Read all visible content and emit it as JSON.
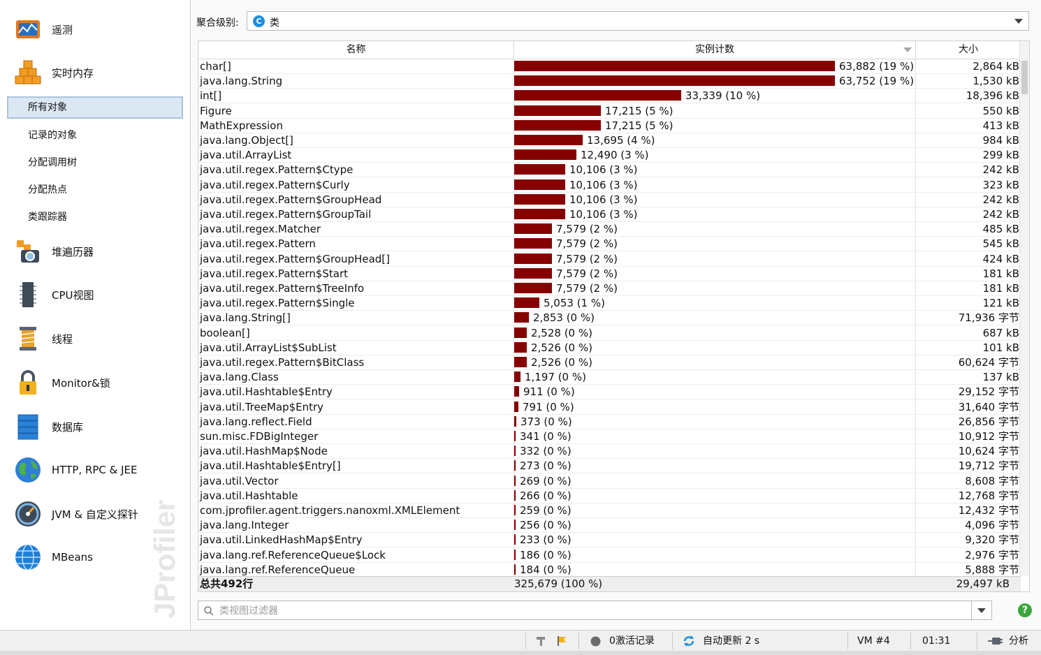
{
  "sidebar": {
    "telemetry": "遥测",
    "live_memory": "实时内存",
    "sub_items": [
      "所有对象",
      "记录的对象",
      "分配调用树",
      "分配热点",
      "类跟踪器"
    ],
    "heap_walker": "堆遍历器",
    "cpu_views": "CPU视图",
    "threads": "线程",
    "monitors": "Monitor&锁",
    "databases": "数据库",
    "http_rpc": "HTTP, RPC & JEE",
    "jvm_probes": "JVM & 自定义探针",
    "mbeans": "MBeans",
    "watermark": "JProfiler"
  },
  "aggregation": {
    "label": "聚合级别:",
    "badge": "C",
    "value": "类"
  },
  "table": {
    "headers": {
      "name": "名称",
      "count": "实例计数",
      "size": "大小"
    },
    "rows": [
      {
        "name": "char[]",
        "count": "63,882 (19 %)",
        "size": "2,864 kB",
        "pct": 19.6
      },
      {
        "name": "java.lang.String",
        "count": "63,752 (19 %)",
        "size": "1,530 kB",
        "pct": 19.6
      },
      {
        "name": "int[]",
        "count": "33,339 (10 %)",
        "size": "18,396 kB",
        "pct": 10.2
      },
      {
        "name": "Figure",
        "count": "17,215 (5 %)",
        "size": "550 kB",
        "pct": 5.3
      },
      {
        "name": "MathExpression",
        "count": "17,215 (5 %)",
        "size": "413 kB",
        "pct": 5.3
      },
      {
        "name": "java.lang.Object[]",
        "count": "13,695 (4 %)",
        "size": "984 kB",
        "pct": 4.2
      },
      {
        "name": "java.util.ArrayList",
        "count": "12,490 (3 %)",
        "size": "299 kB",
        "pct": 3.8
      },
      {
        "name": "java.util.regex.Pattern$Ctype",
        "count": "10,106 (3 %)",
        "size": "242 kB",
        "pct": 3.1
      },
      {
        "name": "java.util.regex.Pattern$Curly",
        "count": "10,106 (3 %)",
        "size": "323 kB",
        "pct": 3.1
      },
      {
        "name": "java.util.regex.Pattern$GroupHead",
        "count": "10,106 (3 %)",
        "size": "242 kB",
        "pct": 3.1
      },
      {
        "name": "java.util.regex.Pattern$GroupTail",
        "count": "10,106 (3 %)",
        "size": "242 kB",
        "pct": 3.1
      },
      {
        "name": "java.util.regex.Matcher",
        "count": "7,579 (2 %)",
        "size": "485 kB",
        "pct": 2.3
      },
      {
        "name": "java.util.regex.Pattern",
        "count": "7,579 (2 %)",
        "size": "545 kB",
        "pct": 2.3
      },
      {
        "name": "java.util.regex.Pattern$GroupHead[]",
        "count": "7,579 (2 %)",
        "size": "424 kB",
        "pct": 2.3
      },
      {
        "name": "java.util.regex.Pattern$Start",
        "count": "7,579 (2 %)",
        "size": "181 kB",
        "pct": 2.3
      },
      {
        "name": "java.util.regex.Pattern$TreeInfo",
        "count": "7,579 (2 %)",
        "size": "181 kB",
        "pct": 2.3
      },
      {
        "name": "java.util.regex.Pattern$Single",
        "count": "5,053 (1 %)",
        "size": "121 kB",
        "pct": 1.55
      },
      {
        "name": "java.lang.String[]",
        "count": "2,853 (0 %)",
        "size": "71,936 字节",
        "pct": 0.88
      },
      {
        "name": "boolean[]",
        "count": "2,528 (0 %)",
        "size": "687 kB",
        "pct": 0.78
      },
      {
        "name": "java.util.ArrayList$SubList",
        "count": "2,526 (0 %)",
        "size": "101 kB",
        "pct": 0.78
      },
      {
        "name": "java.util.regex.Pattern$BitClass",
        "count": "2,526 (0 %)",
        "size": "60,624 字节",
        "pct": 0.78
      },
      {
        "name": "java.lang.Class",
        "count": "1,197 (0 %)",
        "size": "137 kB",
        "pct": 0.37
      },
      {
        "name": "java.util.Hashtable$Entry",
        "count": "911 (0 %)",
        "size": "29,152 字节",
        "pct": 0.28
      },
      {
        "name": "java.util.TreeMap$Entry",
        "count": "791 (0 %)",
        "size": "31,640 字节",
        "pct": 0.24
      },
      {
        "name": "java.lang.reflect.Field",
        "count": "373 (0 %)",
        "size": "26,856 字节",
        "pct": 0.11
      },
      {
        "name": "sun.misc.FDBigInteger",
        "count": "341 (0 %)",
        "size": "10,912 字节",
        "pct": 0.1
      },
      {
        "name": "java.util.HashMap$Node",
        "count": "332 (0 %)",
        "size": "10,624 字节",
        "pct": 0.1
      },
      {
        "name": "java.util.Hashtable$Entry[]",
        "count": "273 (0 %)",
        "size": "19,712 字节",
        "pct": 0.08
      },
      {
        "name": "java.util.Vector",
        "count": "269 (0 %)",
        "size": "8,608 字节",
        "pct": 0.08
      },
      {
        "name": "java.util.Hashtable",
        "count": "266 (0 %)",
        "size": "12,768 字节",
        "pct": 0.08
      },
      {
        "name": "com.jprofiler.agent.triggers.nanoxml.XMLElement",
        "count": "259 (0 %)",
        "size": "12,432 字节",
        "pct": 0.08
      },
      {
        "name": "java.lang.Integer",
        "count": "256 (0 %)",
        "size": "4,096 字节",
        "pct": 0.08
      },
      {
        "name": "java.util.LinkedHashMap$Entry",
        "count": "233 (0 %)",
        "size": "9,320 字节",
        "pct": 0.07
      },
      {
        "name": "java.lang.ref.ReferenceQueue$Lock",
        "count": "186 (0 %)",
        "size": "2,976 字节",
        "pct": 0.06
      },
      {
        "name": "java.lang.ref.ReferenceQueue",
        "count": "184 (0 %)",
        "size": "5,888 字节",
        "pct": 0.06
      }
    ],
    "total": {
      "name": "总共492行",
      "count": "325,679 (100 %)",
      "size": "29,497 kB"
    }
  },
  "filter": {
    "placeholder": "类视图过滤器"
  },
  "help": "?",
  "status": {
    "recordings": "0激活记录",
    "auto_update": "自动更新 2 s",
    "vm": "VM #4",
    "time": "01:31",
    "analysis": "分析"
  },
  "colors": {
    "bar": "#860000",
    "selection": "#dbe7f3",
    "accent": "#1f8ee0"
  }
}
